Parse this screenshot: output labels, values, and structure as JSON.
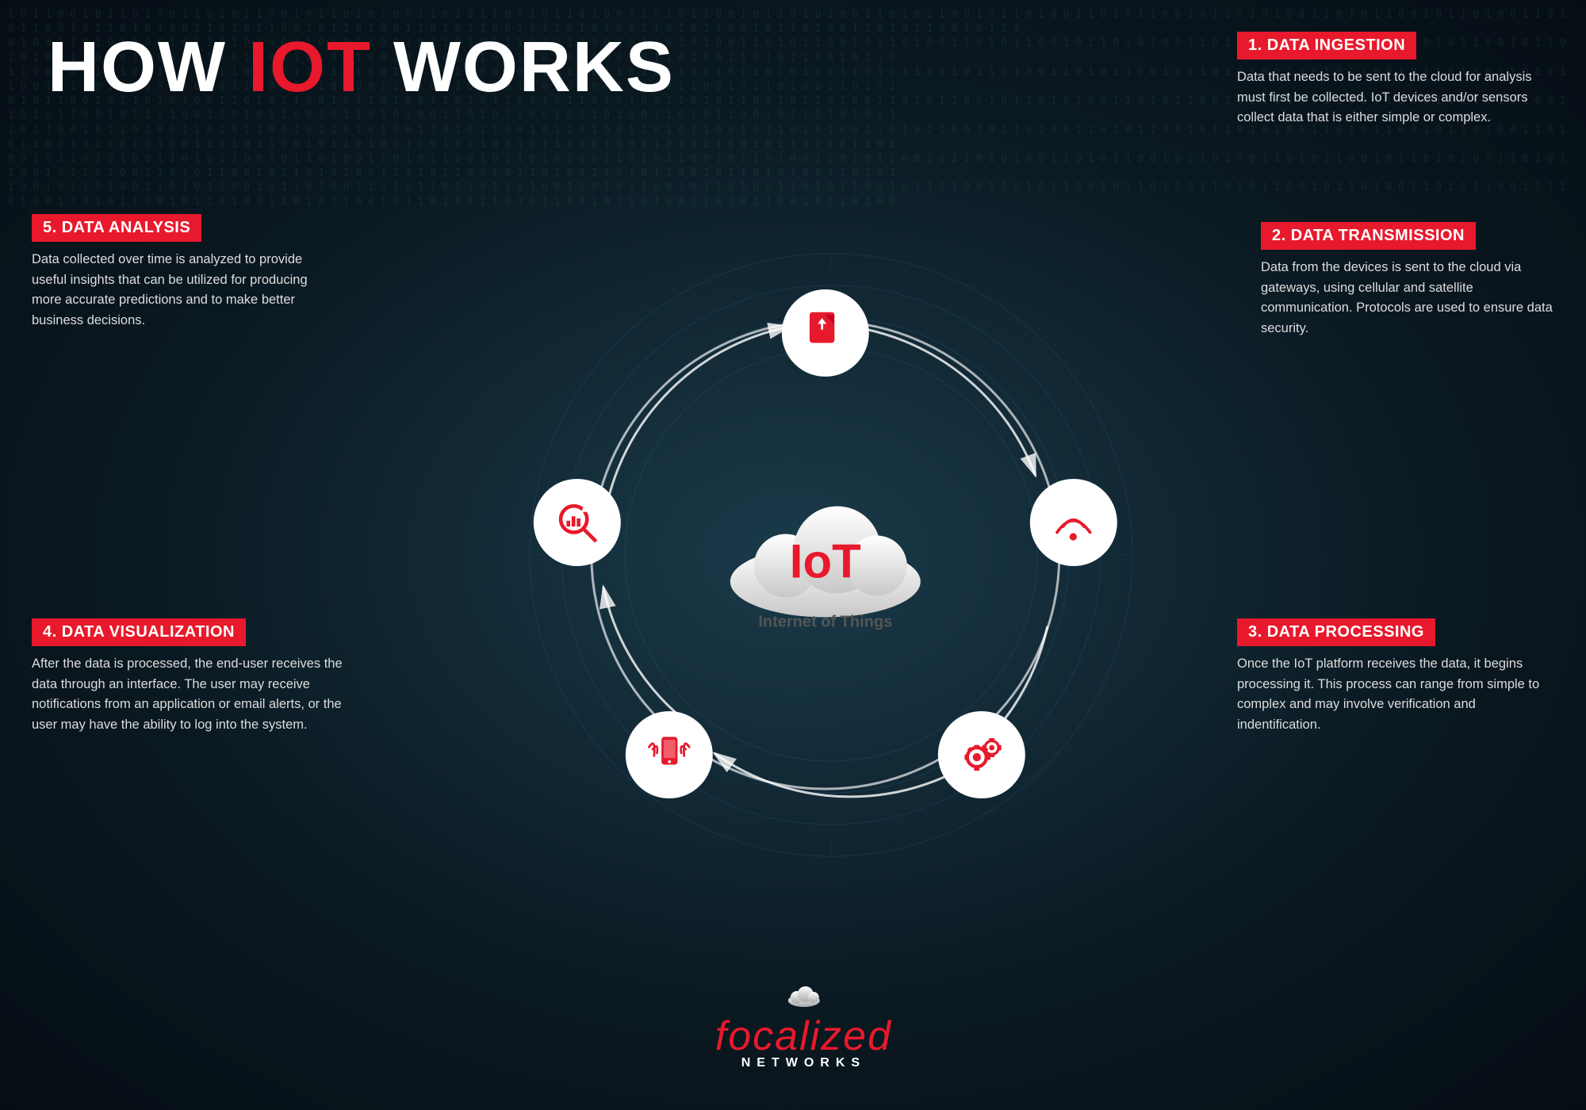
{
  "page": {
    "title_part1": "HOW ",
    "title_iot": "IoT",
    "title_part2": " WORKS",
    "background_binary": "1 0 1 1 0 0 1 0 1 1 0 1 0 0 1 1 0 1 0 1 1 0 0 1 0 1 1 0 1 0 1 0 0 1 1 0 1 0 1 1 0 0 1 0 1 1 0 1 0 0 1 1 0 1 0 1 1 0 0 1 0 1 1 0 1 0 1 0 0 1 1 0 1 0 1 1 0 0 1 0 1 1 0 1 0 0 1 1 0 1 0 1 1 0 0 1 0 1 1 0 1 0 1 0 0 1 1 0 1 0 1 1 0 0 1 0 1 1 0 1 0 0 1 1 0 1 0 1 1 0 0 1 0 1 1 0 1 0 1 0 0 1 1 0"
  },
  "center": {
    "iot_label": "IoT",
    "subtitle": "Internet of Things"
  },
  "sections": [
    {
      "id": 1,
      "number": "1.",
      "title": "DATA INGESTION",
      "text": "Data that needs to be sent to the cloud for analysis must first be collected. IoT devices and/or sensors collect data that is either simple or complex."
    },
    {
      "id": 2,
      "number": "2.",
      "title": "DATA TRANSMISSION",
      "text": "Data from the devices is sent to the cloud via gateways, using cellular and satellite communication. Protocols are used to ensure data security."
    },
    {
      "id": 3,
      "number": "3.",
      "title": "DATA PROCESSING",
      "text": "Once the IoT platform receives the data, it begins processing it. This process can range from simple to complex and may involve verification and indentification."
    },
    {
      "id": 4,
      "number": "4.",
      "title": "DATA VISUALIZATION",
      "text": "After the data is processed, the end-user receives the data through an interface. The user may receive notifications from an application or email alerts, or the user may have the ability to log into the system."
    },
    {
      "id": 5,
      "number": "5.",
      "title": "DATA ANALYSIS",
      "text": "Data collected over time is analyzed to provide useful insights that can be utilized for producing more accurate predictions and to make better business decisions."
    }
  ],
  "logo": {
    "brand": "focalized",
    "sub": "NETWORKS"
  }
}
